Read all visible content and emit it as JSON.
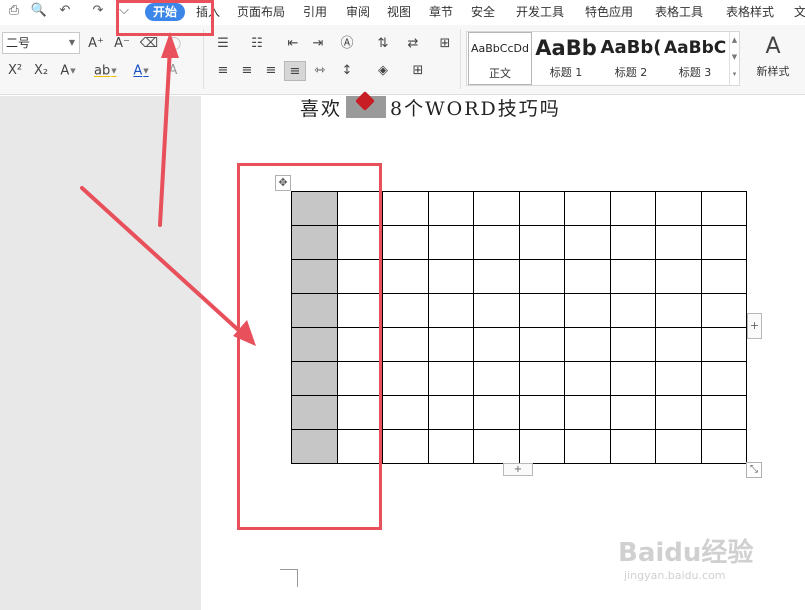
{
  "quick_access": [
    {
      "icon": "print-icon",
      "glyph": "⎙"
    },
    {
      "icon": "print-preview-icon",
      "glyph": "🔍"
    },
    {
      "icon": "undo-icon",
      "glyph": "↶"
    },
    {
      "icon": "redo-icon",
      "glyph": "↷"
    },
    {
      "icon": "customize-chevron-icon",
      "glyph": "⌵"
    }
  ],
  "menu": {
    "tabs": [
      "开始",
      "插入",
      "页面布局",
      "引用",
      "审阅",
      "视图",
      "章节",
      "安全",
      "开发工具",
      "特色应用",
      "表格工具",
      "表格样式",
      "文"
    ],
    "active": "开始"
  },
  "ribbon": {
    "font_size": "二号",
    "grow_font": "A⁺",
    "shrink_font": "A⁻",
    "clear_format": "⌫",
    "superscript": "X²",
    "subscript": "X₂",
    "text_effect": "A",
    "highlight": "ab",
    "font_color": "A",
    "char_border": "A",
    "styles": [
      {
        "sample": "AaBbCcDd",
        "name": "正文"
      },
      {
        "sample": "AaBb",
        "name": "标题 1"
      },
      {
        "sample": "AaBb(",
        "name": "标题 2"
      },
      {
        "sample": "AaBbC",
        "name": "标题 3"
      }
    ],
    "new_style_glyph": "A",
    "new_style_label": "新样式"
  },
  "document": {
    "title_before": "喜欢",
    "title_after": "8个WORD技巧吗",
    "table": {
      "rows": 8,
      "cols": 10,
      "shaded_column": 1
    }
  },
  "colors": {
    "annotation": "#e8505b",
    "active_tab": "#3b86e8",
    "shaded_cell": "#c6c6c6"
  },
  "watermark": {
    "brand": "Baidu经验",
    "site": "jingyan.baidu.com"
  }
}
